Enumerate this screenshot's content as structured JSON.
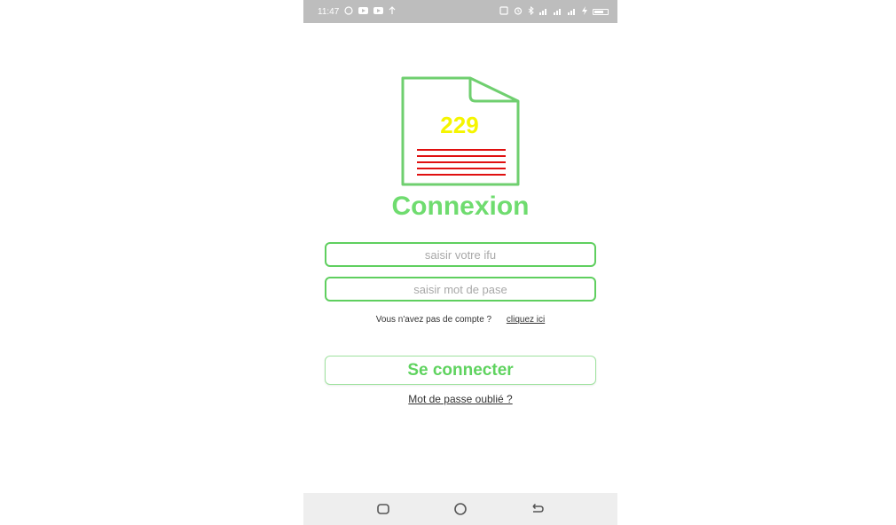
{
  "status_bar": {
    "time": "11:47",
    "left_icons": [
      "whatsapp-icon",
      "youtube-icon",
      "youtube-icon",
      "upload-icon"
    ],
    "right_icons": [
      "nfc-icon",
      "alarm-icon",
      "bluetooth-icon",
      "signal-icon",
      "signal-icon",
      "signal-icon",
      "charging-icon",
      "battery-icon"
    ]
  },
  "logo": {
    "number": "229",
    "number_color": "#f5f500",
    "line_color": "#e01010",
    "outline_color": "#6fcf6f"
  },
  "title": "Connexion",
  "form": {
    "ifu_placeholder": "saisir votre ifu",
    "ifu_value": "",
    "password_placeholder": "saisir mot de pase",
    "password_value": ""
  },
  "signup": {
    "prompt": "Vous n'avez pas de compte ?",
    "link_label": "cliquez ici"
  },
  "connect_button_label": "Se connecter",
  "forgot_password_label": "Mot de passe oublié ?",
  "colors": {
    "accent": "#6fdc6f",
    "status_bar": "#bdbdbd",
    "nav_bar": "#eeeeee"
  }
}
